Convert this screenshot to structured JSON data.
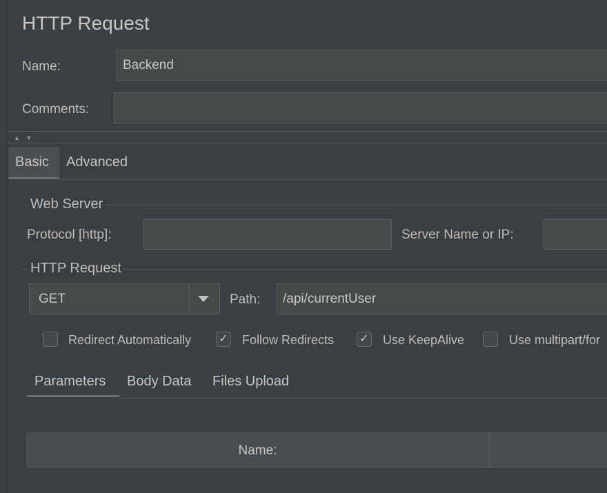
{
  "header": {
    "title": "HTTP Request"
  },
  "form": {
    "name_label": "Name:",
    "name_value": "Backend",
    "comments_label": "Comments:",
    "comments_value": ""
  },
  "collapse_arrows": "▲ ▼",
  "main_tabs": [
    {
      "label": "Basic",
      "active": true
    },
    {
      "label": "Advanced",
      "active": false
    }
  ],
  "web_server": {
    "title": "Web Server",
    "protocol_label": "Protocol [http]:",
    "protocol_value": "",
    "server_label": "Server Name or IP:",
    "server_value": ""
  },
  "http_request": {
    "title": "HTTP Request",
    "method": "GET",
    "path_label": "Path:",
    "path_value": "/api/currentUser"
  },
  "options": [
    {
      "label": "Redirect Automatically",
      "checked": false
    },
    {
      "label": "Follow Redirects",
      "checked": true
    },
    {
      "label": "Use KeepAlive",
      "checked": true
    },
    {
      "label": "Use multipart/for",
      "checked": false
    }
  ],
  "sub_tabs": [
    {
      "label": "Parameters",
      "active": true
    },
    {
      "label": "Body Data",
      "active": false
    },
    {
      "label": "Files Upload",
      "active": false
    }
  ],
  "table": {
    "columns": [
      "Name:",
      ""
    ]
  },
  "icons": {
    "dropdown": "chevron-down-icon",
    "check": "check-icon"
  }
}
